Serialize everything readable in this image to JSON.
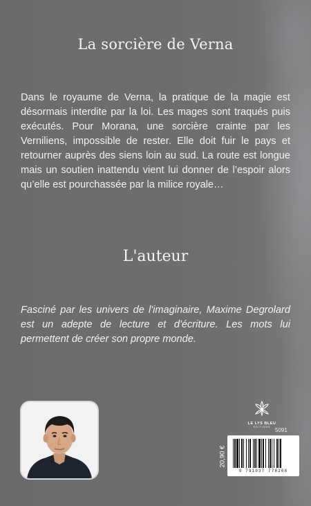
{
  "book": {
    "title": "La sorcière de Verna",
    "synopsis": "Dans le royaume de Verna, la pratique de la magie est désormais interdite par la loi. Les mages sont traqués puis exécutés. Pour Morana, une sorcière crainte par les Verniliens, impossible de rester. Elle doit fuir le pays et retourner auprès des siens loin au sud. La route est longue mais un soutien inattendu vient lui donner de l’espoir alors qu’elle est pourchassée par la milice royale…"
  },
  "author": {
    "heading": "L'auteur",
    "bio": "Fasciné par les univers de l'imaginaire, Maxime Degrolard est un adepte de lecture et d'écriture. Les mots lui permettent de créer son propre monde."
  },
  "publisher": {
    "name": "LE LYS BLEU",
    "subtitle": "ÉDITIONS",
    "logo_icon": "lily-flower-icon"
  },
  "back_matter": {
    "code": "5091",
    "price": "20,90 €",
    "barcode_digits": "9 791037 778208"
  },
  "colors": {
    "background": "#6e6e6e",
    "text": "#f2f2f2"
  }
}
